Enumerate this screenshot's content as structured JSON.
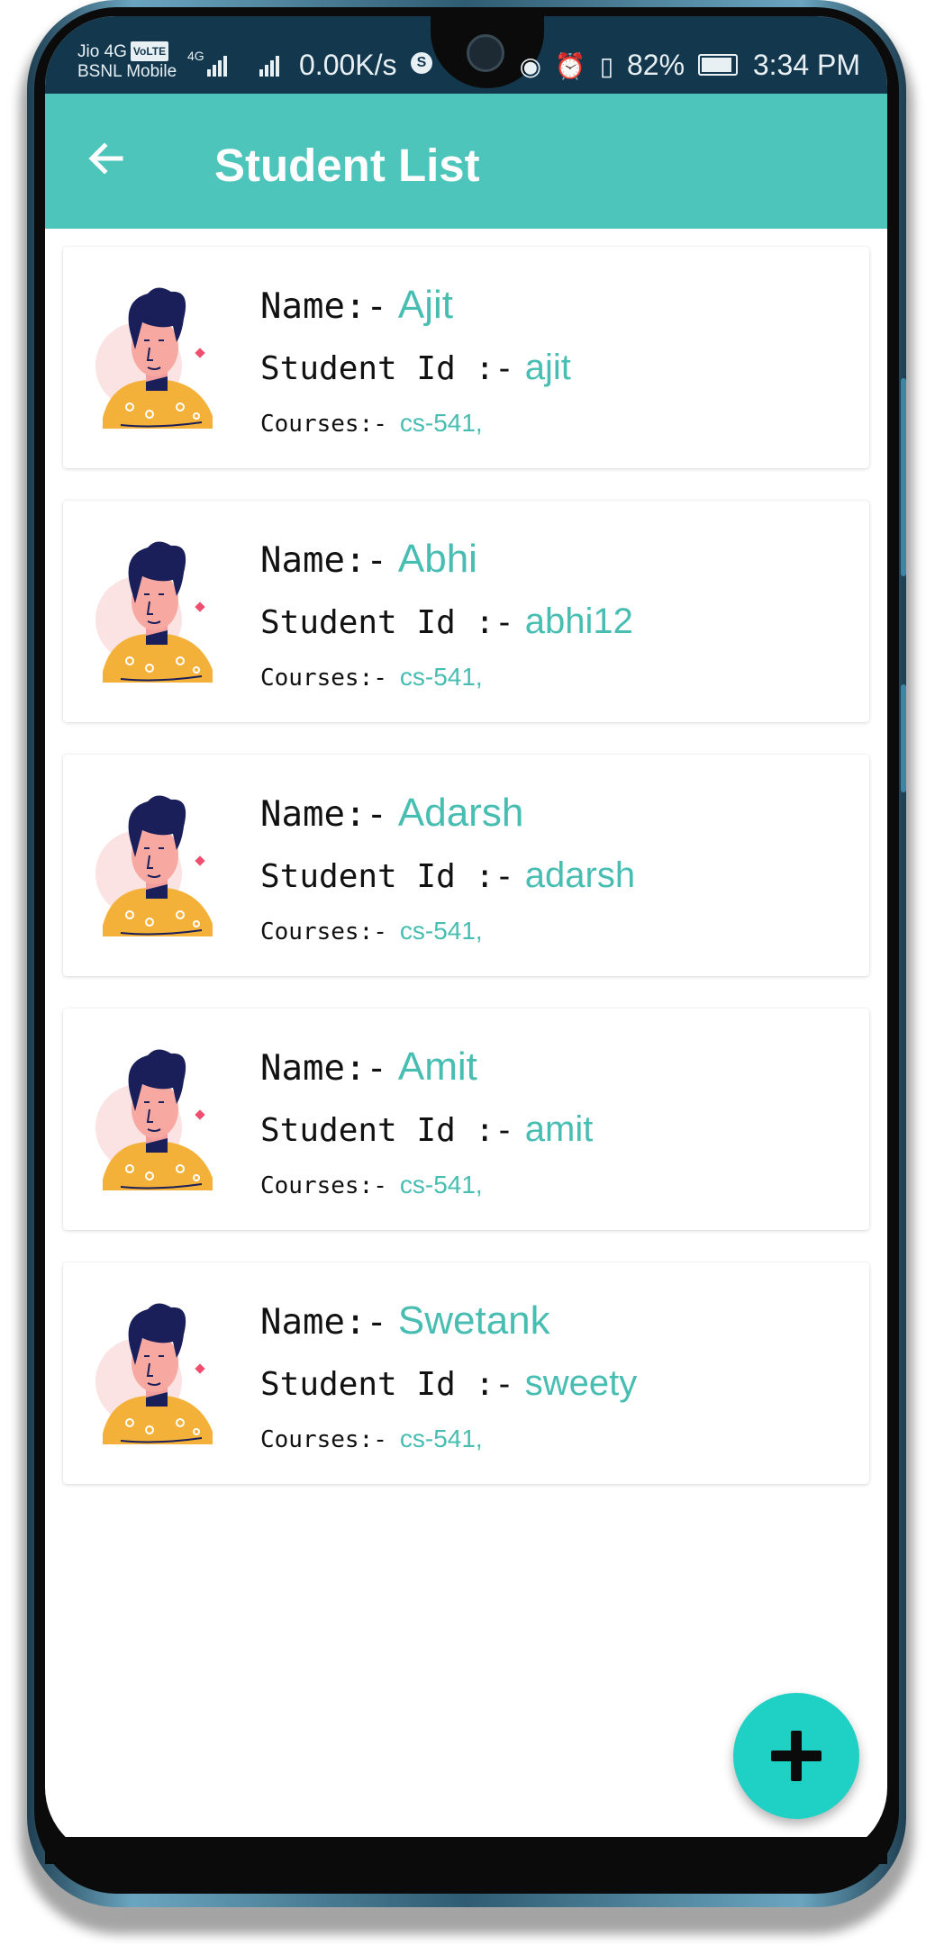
{
  "status_bar": {
    "carrier1": "Jio 4G",
    "volte": "VoLTE",
    "carrier2": "BSNL Mobile",
    "network_type": "4G",
    "speed": "0.00K/s",
    "battery": "82%",
    "time": "3:34 PM",
    "icons": [
      "eye-icon",
      "alarm-icon",
      "vibrate-icon",
      "battery-icon"
    ]
  },
  "app_bar": {
    "title": "Student List",
    "back_icon": "arrow-left-icon",
    "color": "#4ec5bb"
  },
  "labels": {
    "name": "Name:-",
    "student_id": "Student Id :-",
    "courses": "Courses:-"
  },
  "students": [
    {
      "name": "Ajit",
      "id": "ajit",
      "courses": "cs-541,"
    },
    {
      "name": "Abhi",
      "id": "abhi12",
      "courses": "cs-541,"
    },
    {
      "name": "Adarsh",
      "id": "adarsh",
      "courses": "cs-541,"
    },
    {
      "name": "Amit",
      "id": "amit",
      "courses": "cs-541,"
    },
    {
      "name": "Swetank",
      "id": "sweety",
      "courses": "cs-541,"
    }
  ],
  "fab": {
    "icon": "plus-icon",
    "color": "#1fd0c4"
  },
  "colors": {
    "accent_text": "#48bdb2",
    "status_bar": "#13384d"
  }
}
